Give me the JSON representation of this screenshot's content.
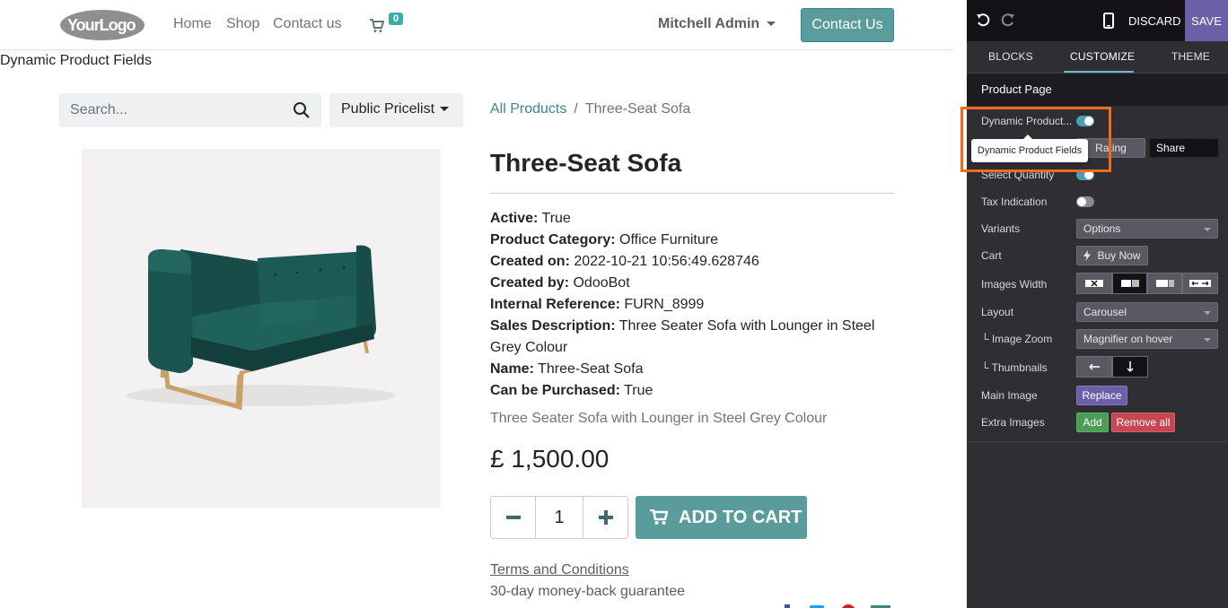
{
  "header": {
    "logo_text": "YourLogo",
    "nav": [
      "Home",
      "Shop",
      "Contact us"
    ],
    "cart_count": "0",
    "user": "Mitchell Admin",
    "contact_button": "Contact Us"
  },
  "snippet_label": "Dynamic Product Fields",
  "search": {
    "placeholder": "Search..."
  },
  "pricelist": "Public Pricelist",
  "breadcrumb": {
    "parent": "All Products",
    "current": "Three-Seat Sofa"
  },
  "product": {
    "title": "Three-Seat Sofa",
    "fields": [
      {
        "label": "Active:",
        "value": "True"
      },
      {
        "label": "Product Category:",
        "value": "Office Furniture"
      },
      {
        "label": "Created on:",
        "value": "2022-10-21 10:56:49.628746"
      },
      {
        "label": "Created by:",
        "value": "OdooBot"
      },
      {
        "label": "Internal Reference:",
        "value": "FURN_8999"
      },
      {
        "label": "Sales Description:",
        "value": "Three Seater Sofa with Lounger in Steel Grey Colour"
      },
      {
        "label": "Name:",
        "value": "Three-Seat Sofa"
      },
      {
        "label": "Can be Purchased:",
        "value": "True"
      }
    ],
    "description": "Three Seater Sofa with Lounger in Steel Grey Colour",
    "price": "£ 1,500.00",
    "quantity": "1",
    "add_to_cart": "ADD TO CART",
    "terms": "Terms and Conditions",
    "guarantee": "30-day money-back guarantee"
  },
  "panel": {
    "discard": "DISCARD",
    "save": "SAVE",
    "tabs": [
      "BLOCKS",
      "CUSTOMIZE",
      "THEME"
    ],
    "section": "Product Page",
    "dynamic_product": {
      "label": "Dynamic Product...",
      "enabled": true
    },
    "tooltip": "Dynamic Product Fields",
    "rating_button": "Rating",
    "share_button": "Share",
    "select_quantity": {
      "label": "Select Quantity",
      "enabled": true
    },
    "tax_indication": {
      "label": "Tax Indication",
      "enabled": false
    },
    "variants": {
      "label": "Variants",
      "value": "Options"
    },
    "cart": {
      "label": "Cart",
      "value": "Buy Now"
    },
    "images_width": {
      "label": "Images Width"
    },
    "layout": {
      "label": "Layout",
      "value": "Carousel"
    },
    "image_zoom": {
      "label": "└ Image Zoom",
      "value": "Magnifier on hover"
    },
    "thumbnails": {
      "label": "└ Thumbnails"
    },
    "main_image": {
      "label": "Main Image",
      "button": "Replace"
    },
    "extra_images": {
      "label": "Extra Images",
      "add": "Add",
      "remove": "Remove all"
    }
  },
  "colors": {
    "accent": "#5a9c9c",
    "panel_bg": "#2e2e33",
    "save_purple": "#6b5fa8",
    "highlight_orange": "#f26b1d"
  }
}
